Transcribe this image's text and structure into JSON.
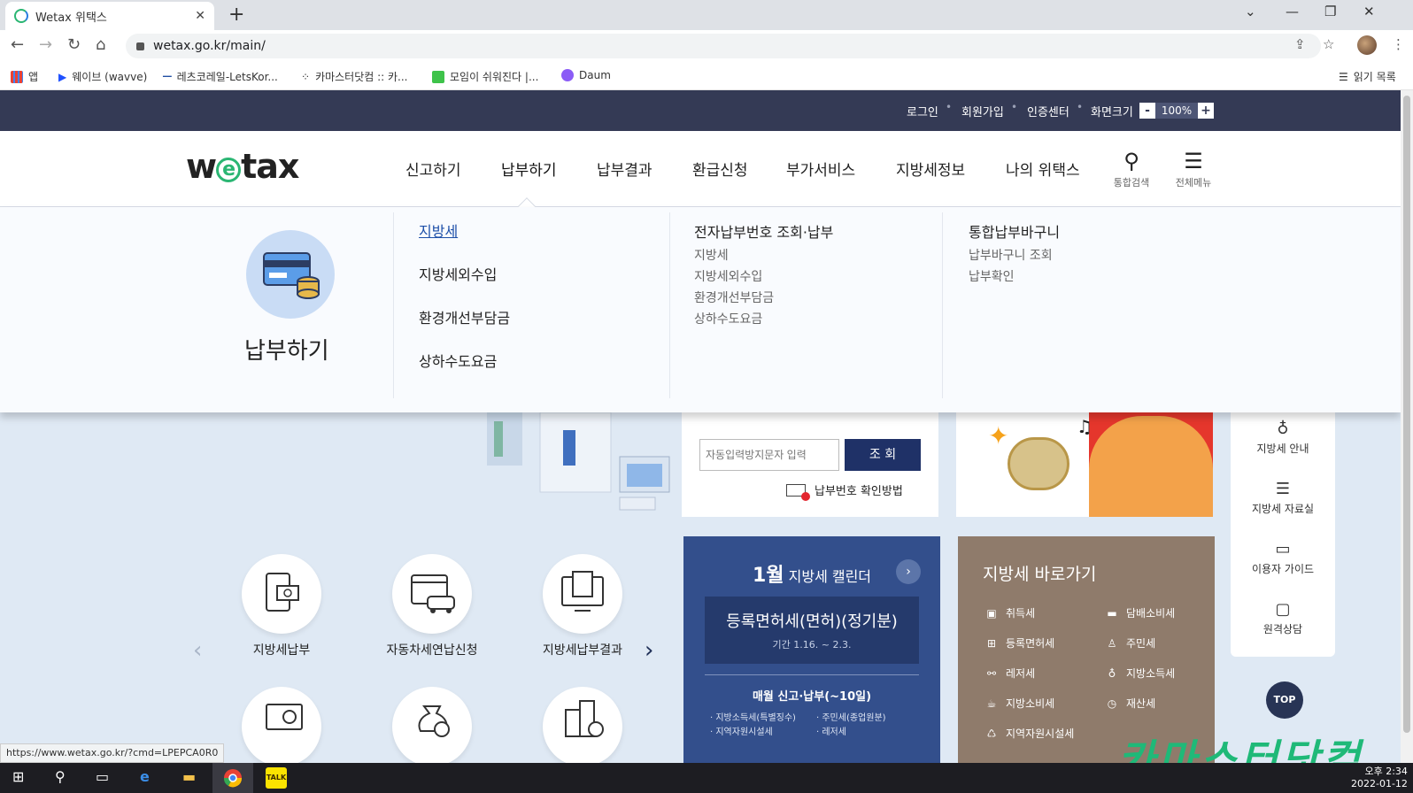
{
  "browser": {
    "tab_title": "Wetax 위택스",
    "url": "wetax.go.kr/main/",
    "bookmarks": [
      "앱",
      "웨이브 (wavve)",
      "레츠코레일-LetsKor...",
      "카마스터닷컴 :: 카...",
      "모임이 쉬워진다 |...",
      "Daum"
    ],
    "reading_list": "읽기 목록",
    "status_url": "https://www.wetax.go.kr/?cmd=LPEPCA0R0"
  },
  "util_links": [
    "로그인",
    "회원가입",
    "인증센터",
    "화면크기"
  ],
  "zoom": {
    "minus": "-",
    "value": "100%",
    "plus": "+"
  },
  "logo": {
    "w": "w",
    "e": "e",
    "rest": "tax"
  },
  "gnb": [
    "신고하기",
    "납부하기",
    "납부결과",
    "환급신청",
    "부가서비스",
    "지방세정보",
    "나의 위택스"
  ],
  "header_icons": {
    "search": "통합검색",
    "menu": "전체메뉴"
  },
  "mega": {
    "title": "납부하기",
    "left_items": [
      "지방세",
      "지방세외수입",
      "환경개선부담금",
      "상하수도요금"
    ],
    "col2": {
      "heading": "전자납부번호 조회·납부",
      "items": [
        "지방세",
        "지방세외수입",
        "환경개선부담금",
        "상하수도요금"
      ]
    },
    "col3": {
      "heading": "통합납부바구니",
      "items": [
        "납부바구니 조회",
        "납부확인"
      ]
    }
  },
  "services": [
    "지방세납부",
    "자동차세연납신청",
    "지방세납부결과"
  ],
  "captcha": {
    "placeholder": "자동입력방지문자 입력",
    "button": "조 회",
    "help": "납부번호 확인방법"
  },
  "calendar": {
    "month": "1월",
    "title": "지방세 캘린더",
    "event": "등록면허세(면허)(정기분)",
    "period": "기간 1.16. ~ 2.3.",
    "sub": "매월 신고·납부(~10일)",
    "items": [
      "지방소득세(특별징수)",
      "주민세(종업원분)",
      "지역자원시설세",
      "레저세"
    ]
  },
  "shortcuts": {
    "title": "지방세 바로가기",
    "items": [
      "취득세",
      "담배소비세",
      "등록면허세",
      "주민세",
      "레저세",
      "지방소득세",
      "지방소비세",
      "재산세",
      "지역자원시설세"
    ]
  },
  "quick": [
    "지방세 안내",
    "지방세 자료실",
    "이용자 가이드",
    "원격상담"
  ],
  "top_btn": "TOP",
  "watermark": "카마스터닷컴",
  "clock": {
    "time": "오후 2:34",
    "date": "2022-01-12"
  }
}
